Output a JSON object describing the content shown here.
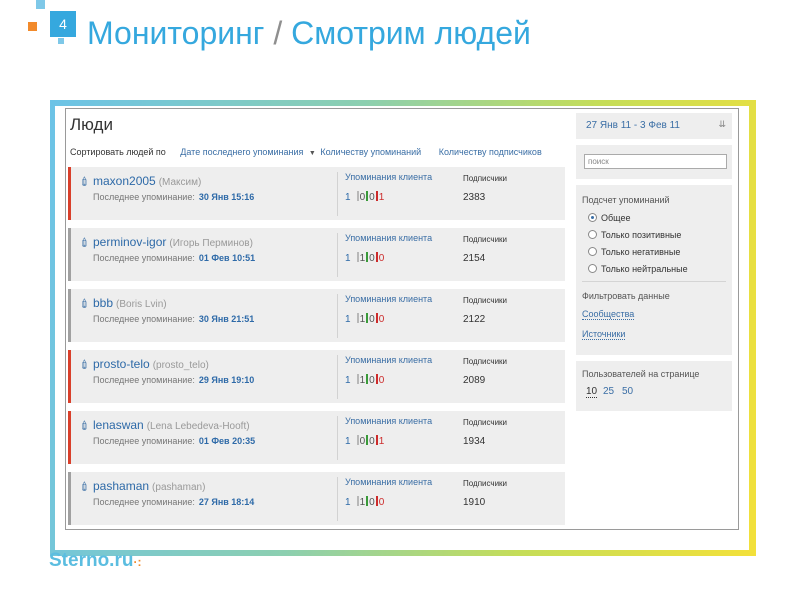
{
  "slide": {
    "number": "4",
    "title_main": "Мониторинг",
    "title_sep": "/",
    "title_sub": "Смотрим людей",
    "logo": "Sterno.ru",
    "logo_dots": "·:"
  },
  "colors": {
    "accent": "#35a8de",
    "link": "#3a6ea5",
    "positive": "#3a9a3a",
    "negative": "#cc2b2b"
  },
  "people": {
    "heading": "Люди",
    "sort_label": "Сортировать людей по",
    "sort_options": [
      "Дате последнего упоминания",
      "Количеству упоминаний",
      "Количеству подписчиков"
    ],
    "last_mention_label": "Последнее упоминание:",
    "mentions_label": "Упоминания клиента",
    "subscribers_label": "Подписчики",
    "cards": [
      {
        "username": "maxon2005",
        "realname": "(Максим)",
        "date": "30 Янв 15:16",
        "total": "1",
        "pos": "0",
        "zero": "0",
        "neg": "1",
        "subscribers": "2383",
        "sentiment": "negative"
      },
      {
        "username": "perminov-igor",
        "realname": "(Игорь Перминов)",
        "date": "01 Фев 10:51",
        "total": "1",
        "pos": "1",
        "zero": "0",
        "neg": "0",
        "subscribers": "2154",
        "sentiment": "positive"
      },
      {
        "username": "bbb",
        "realname": "(Boris Lvin)",
        "date": "30 Янв 21:51",
        "total": "1",
        "pos": "1",
        "zero": "0",
        "neg": "0",
        "subscribers": "2122",
        "sentiment": "positive"
      },
      {
        "username": "prosto-telo",
        "realname": "(prosto_telo)",
        "date": "29 Янв 19:10",
        "total": "1",
        "pos": "1",
        "zero": "0",
        "neg": "0",
        "subscribers": "2089",
        "sentiment": "negative"
      },
      {
        "username": "lenaswan",
        "realname": "(Lena Lebedeva-Hooft)",
        "date": "01 Фев 20:35",
        "total": "1",
        "pos": "0",
        "zero": "0",
        "neg": "1",
        "subscribers": "1934",
        "sentiment": "negative"
      },
      {
        "username": "pashaman",
        "realname": "(pashaman)",
        "date": "27 Янв 18:14",
        "total": "1",
        "pos": "1",
        "zero": "0",
        "neg": "0",
        "subscribers": "1910",
        "sentiment": "positive"
      }
    ]
  },
  "sidebar": {
    "date_range": "27 Янв 11 - 3 Фев 11",
    "search_placeholder": "поиск",
    "count_title": "Подсчет упоминаний",
    "count_options": [
      "Общее",
      "Только позитивные",
      "Только негативные",
      "Только нейтральные"
    ],
    "count_selected": "Общее",
    "filter_title": "Фильтровать данные",
    "filter_links": [
      "Сообщества",
      "Источники"
    ],
    "per_page_title": "Пользователей на странице",
    "per_page_options": [
      "10",
      "25",
      "50"
    ],
    "per_page_selected": "10"
  }
}
